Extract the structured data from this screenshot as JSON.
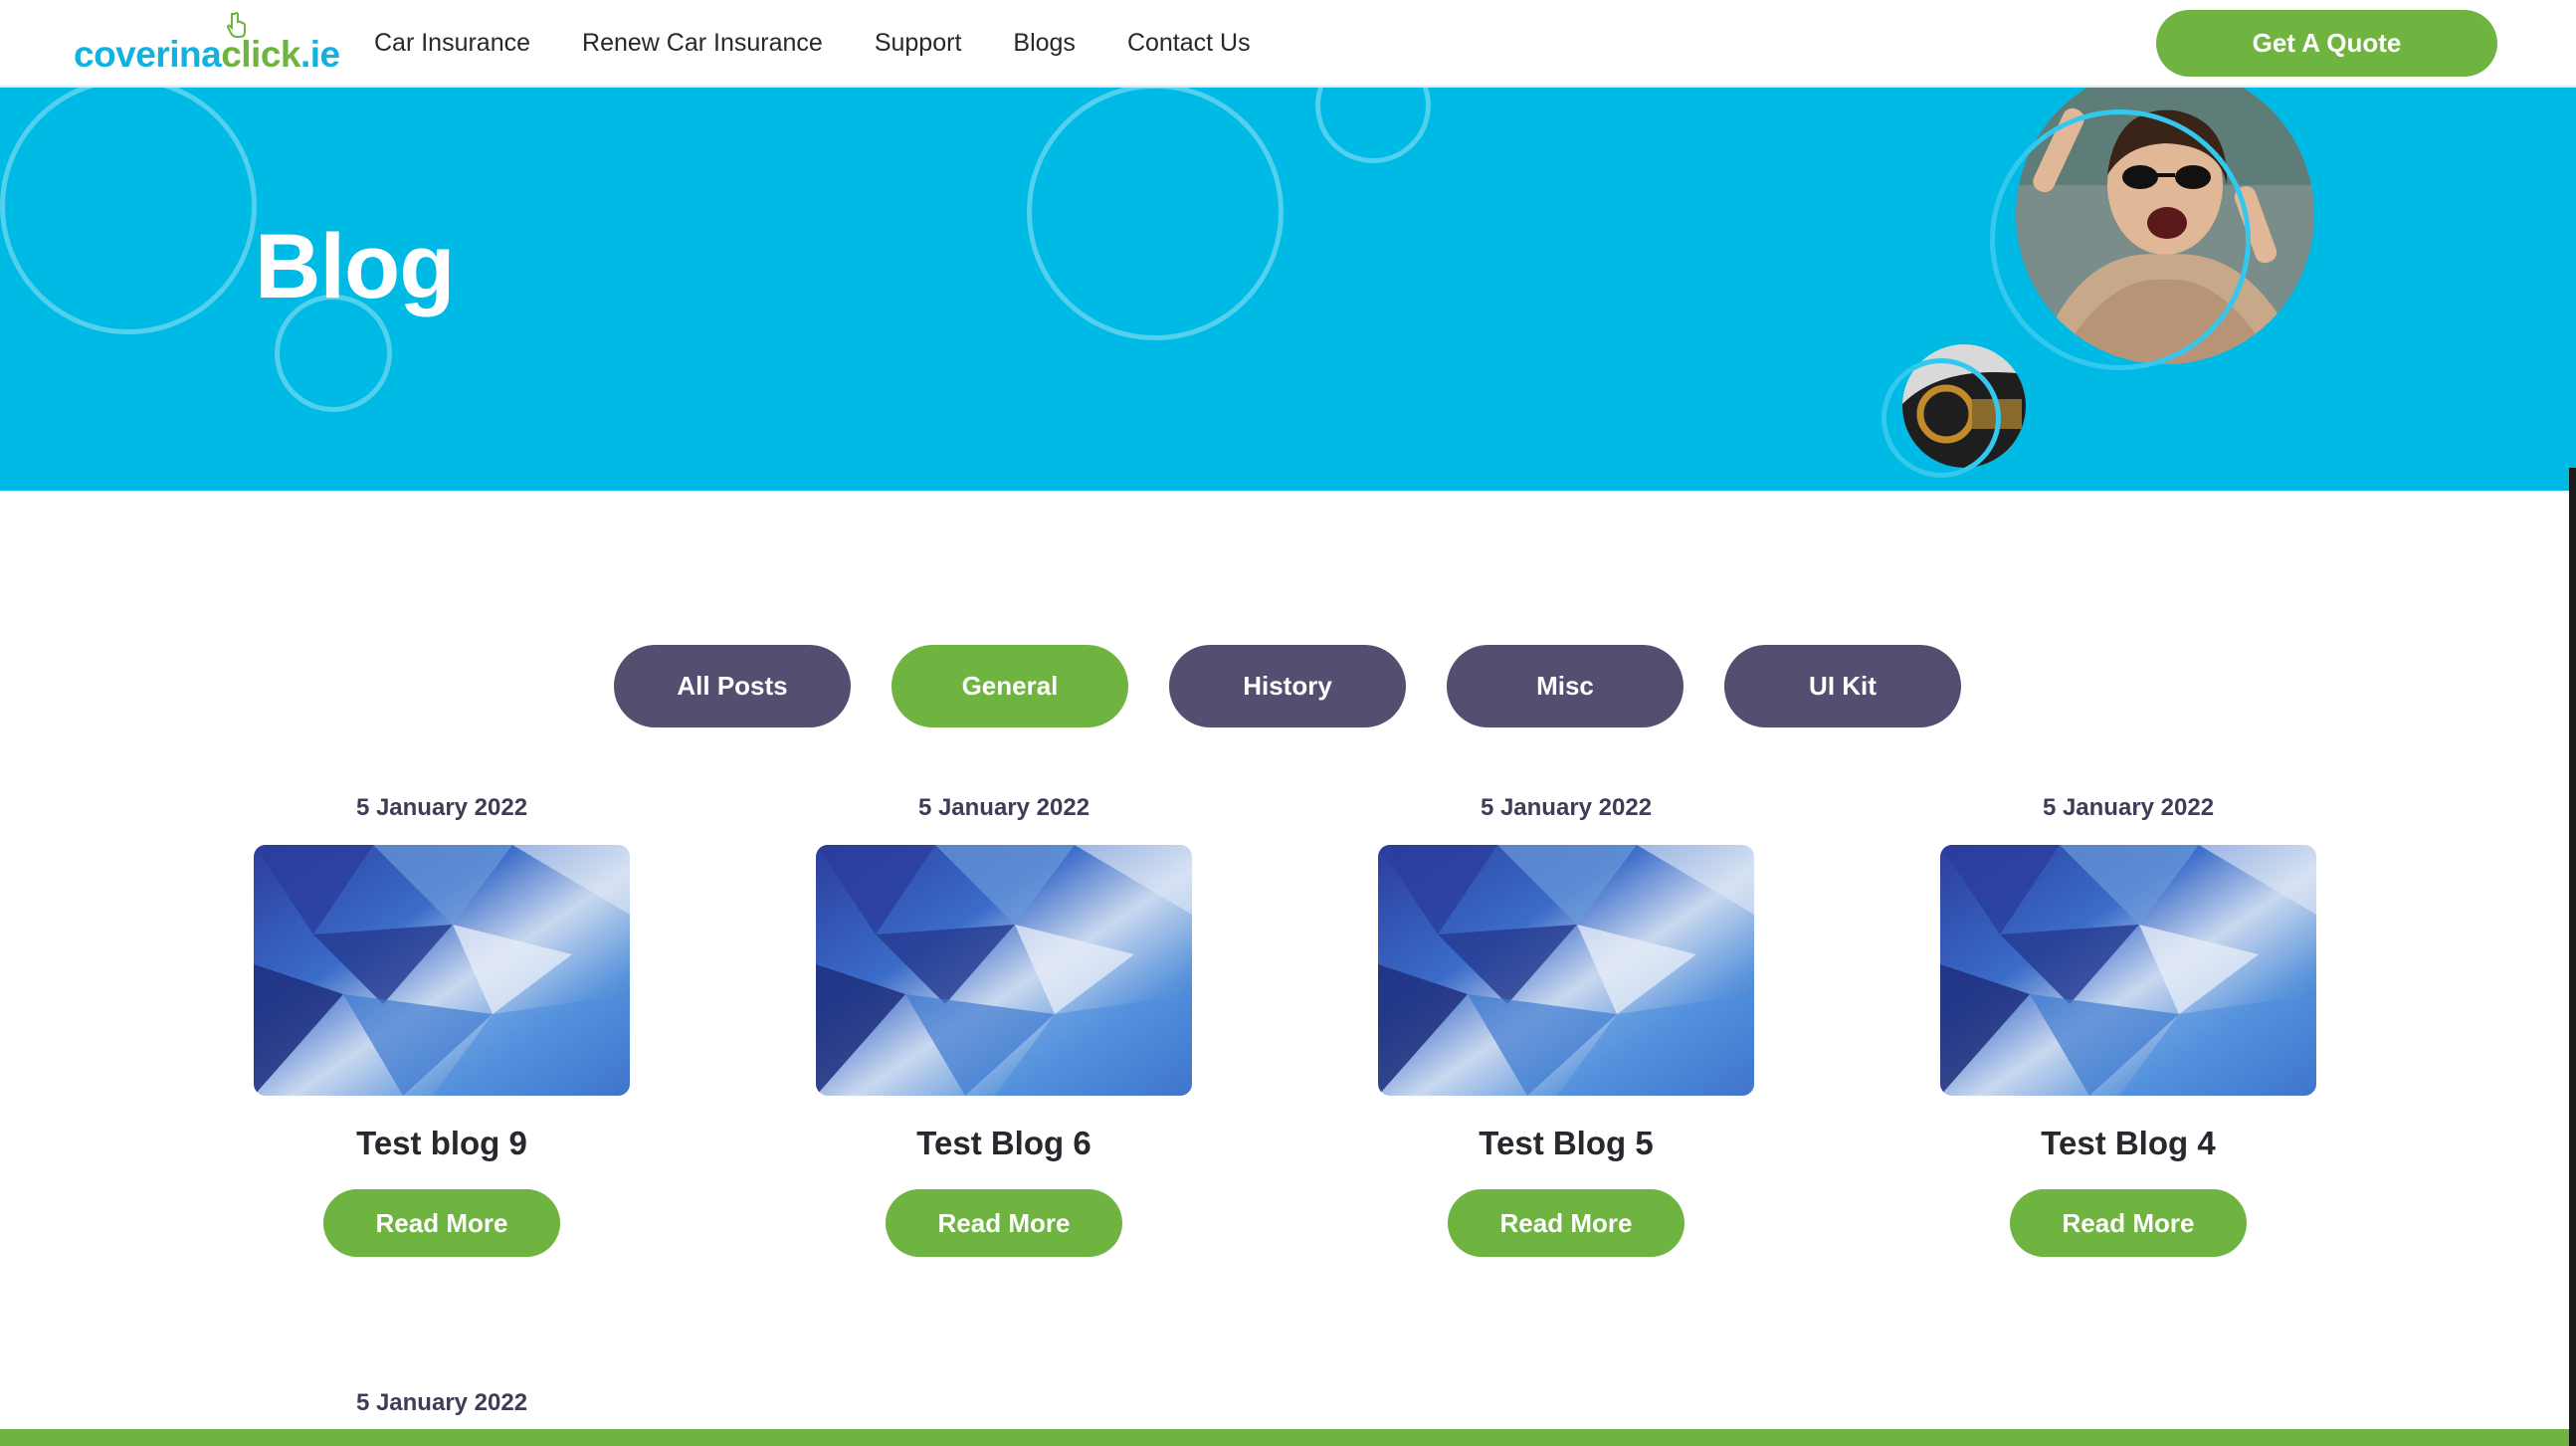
{
  "brand": {
    "logo_part1": "coverina",
    "logo_part2": "click",
    "logo_part3": ".ie",
    "primary_green": "#6fb340",
    "hero_blue": "#00bae6",
    "pill_dark": "#524f70"
  },
  "nav": {
    "items": [
      {
        "label": "Car Insurance"
      },
      {
        "label": "Renew Car Insurance"
      },
      {
        "label": "Support"
      },
      {
        "label": "Blogs"
      },
      {
        "label": "Contact Us"
      }
    ],
    "cta_label": "Get A Quote"
  },
  "hero": {
    "title": "Blog",
    "images": [
      "woman-photo",
      "car-interior-photo"
    ]
  },
  "filters": {
    "items": [
      {
        "label": "All Posts",
        "active": false
      },
      {
        "label": "General",
        "active": true
      },
      {
        "label": "History",
        "active": false
      },
      {
        "label": "Misc",
        "active": false
      },
      {
        "label": "UI Kit",
        "active": false
      }
    ]
  },
  "posts": [
    {
      "date": "5 January 2022",
      "title": "Test blog 9",
      "button": "Read More"
    },
    {
      "date": "5 January 2022",
      "title": "Test Blog 6",
      "button": "Read More"
    },
    {
      "date": "5 January 2022",
      "title": "Test Blog 5",
      "button": "Read More"
    },
    {
      "date": "5 January 2022",
      "title": "Test Blog 4",
      "button": "Read More"
    }
  ],
  "next_row": {
    "date": "5 January 2022"
  }
}
